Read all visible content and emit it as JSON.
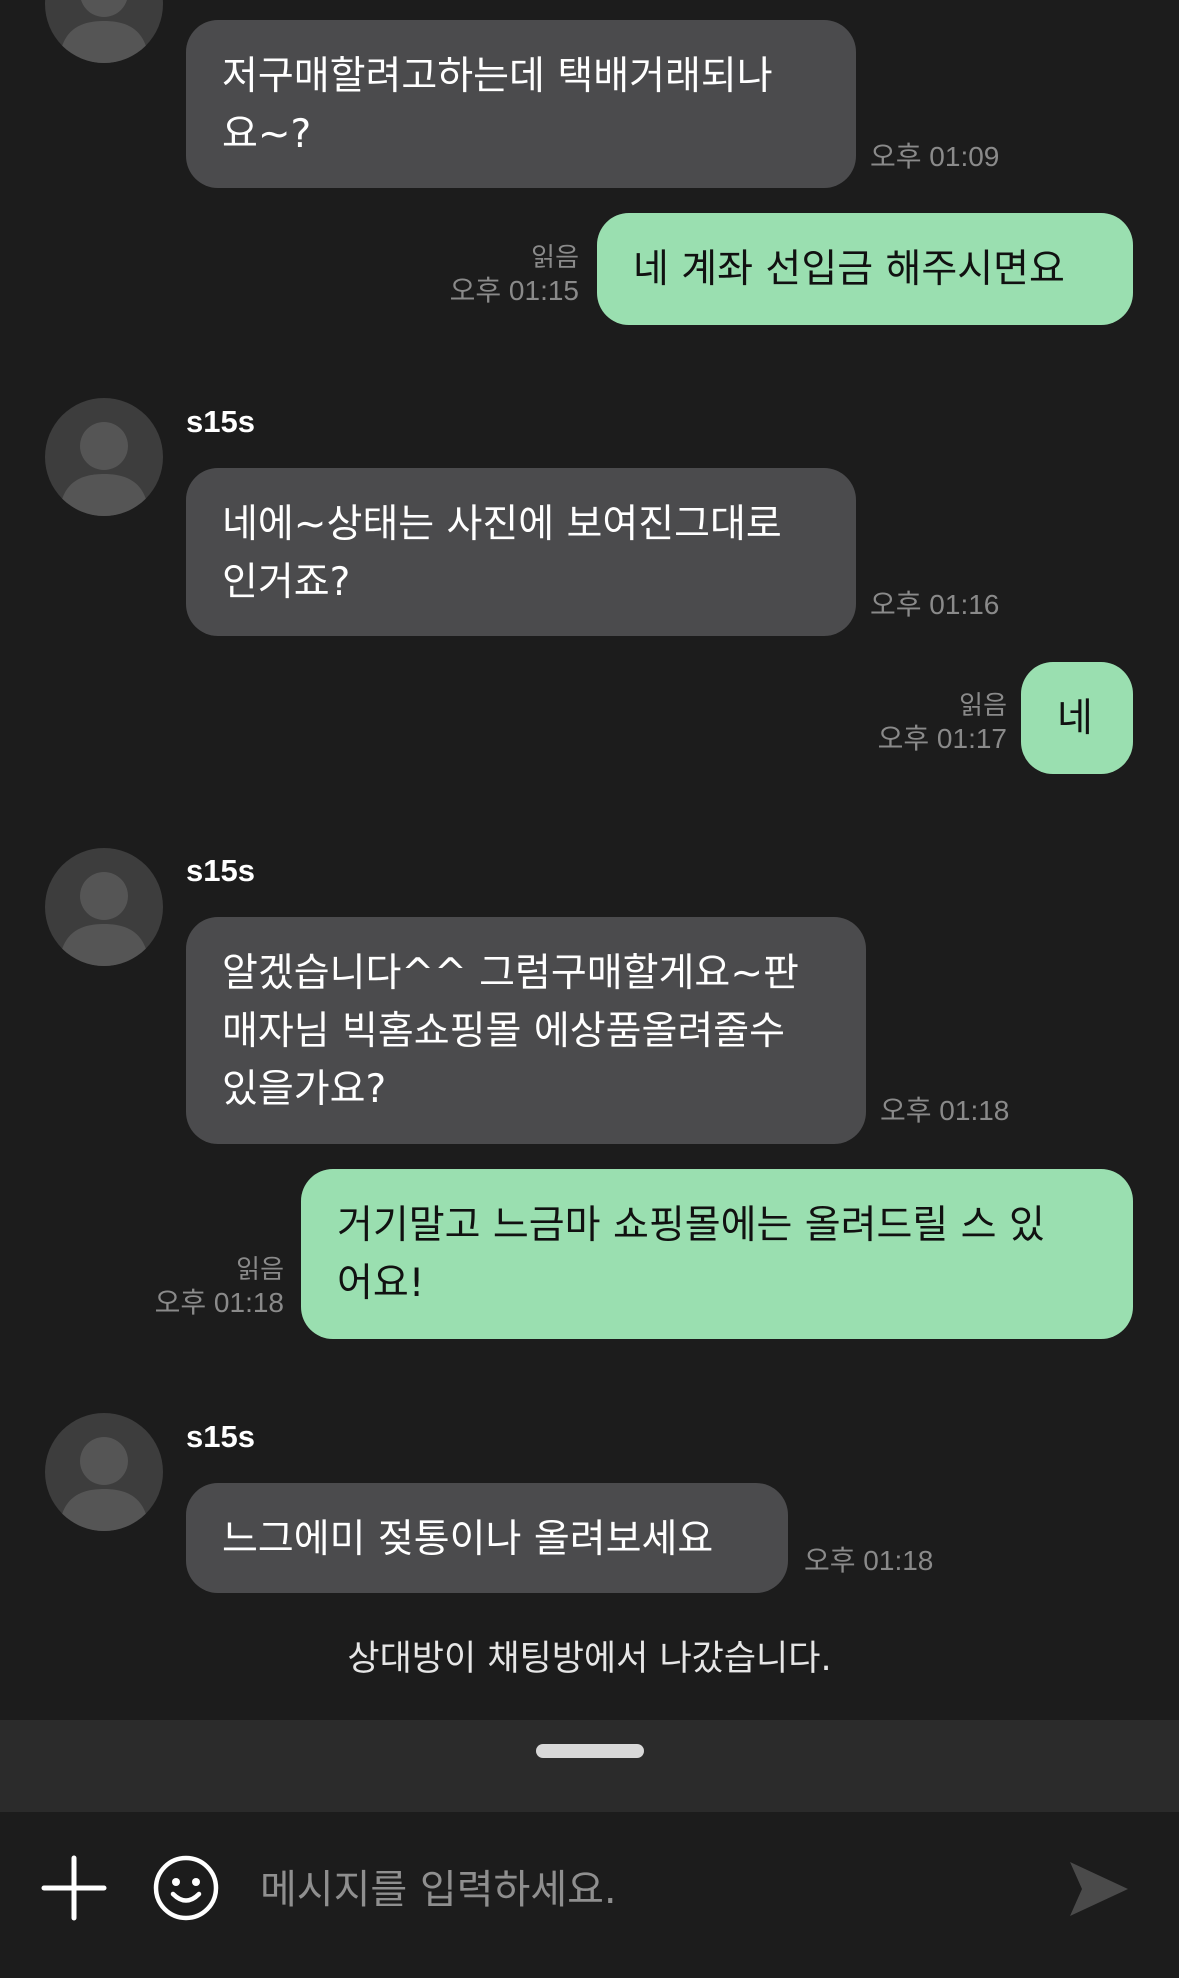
{
  "messages": {
    "m1": {
      "text": "저구매할려고하는데 택배거래되나\n요~?",
      "time": "오후 01:09"
    },
    "m2": {
      "text": "네 계좌 선입금 해주시면요",
      "read": "읽음",
      "time": "오후 01:15"
    },
    "m3": {
      "sender": "s15s",
      "text": "네에~상태는 사진에 보여진그대로\n인거죠?",
      "time": "오후 01:16"
    },
    "m4": {
      "text": "네",
      "read": "읽음",
      "time": "오후 01:17"
    },
    "m5": {
      "sender": "s15s",
      "text": "알겠습니다^^ 그럼구매할게요~판\n매자님 빅홈쇼핑몰 에상품올려줄수\n있을가요?",
      "time": "오후 01:18"
    },
    "m6": {
      "text": "거기말고 느금마 쇼핑몰에는 올려드릴 스 있\n어요!",
      "read": "읽음",
      "time": "오후 01:18"
    },
    "m7": {
      "sender": "s15s",
      "text": "느그에미 젖통이나 올려보세요",
      "time": "오후 01:18"
    }
  },
  "system_message": "상대방이 채팅방에서 나갔습니다.",
  "composer": {
    "placeholder": "메시지를 입력하세요.",
    "add_icon": "plus-icon",
    "emoji_icon": "smiley-icon",
    "send_icon": "send-icon"
  },
  "colors": {
    "background": "#1c1c1c",
    "incoming_bubble": "#4b4b4d",
    "outgoing_bubble": "#9adfb0",
    "meta_text": "#8a8a8a"
  }
}
